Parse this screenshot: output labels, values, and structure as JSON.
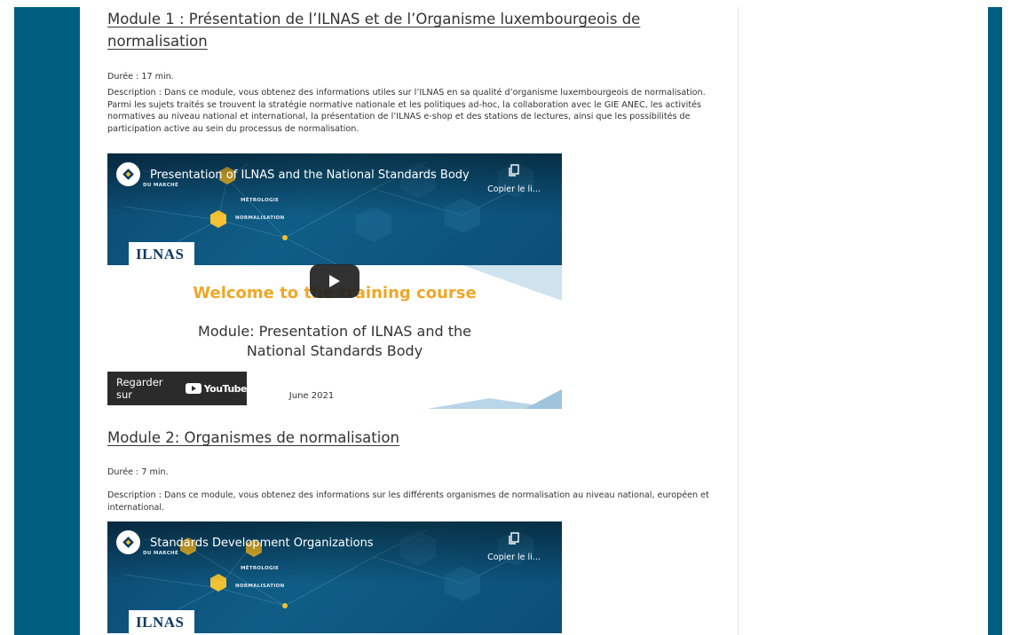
{
  "modules": [
    {
      "title": "Module 1 : Présentation de l’ILNAS et de l’Organisme luxembourgeois de normalisation",
      "duration": "Durée : 17 min.",
      "description": "Description : Dans ce module, vous obtenez des informations utiles sur l’ILNAS en sa qualité d’organisme luxembourgeois de normalisation. Parmi les sujets traités se trouvent la stratégie normative nationale et les politiques ad-hoc, la collaboration avec le GIE ANEC, les activités normatives au niveau national et international, la présentation de l’ILNAS e-shop et des stations de lectures, ainsi que les possibilités de participation active au sein du processus de normalisation.",
      "video": {
        "title": "Presentation of ILNAS and the National Standards Body",
        "copy_label": "Copier le li...",
        "welcome": "Welcome to the training course",
        "module_line1": "Module: Presentation of ILNAS and the",
        "module_line2": "National Standards Body",
        "date": "June 2021",
        "watch_label": "Regarder sur",
        "youtube_word": "YouTube",
        "logo_text": "ILNAS",
        "tag_metrologie": "MÉTROLOGIE",
        "tag_normalisation": "NORMALISATION",
        "tag_marche": "DU MARCHÉ"
      }
    },
    {
      "title": "Module 2: Organismes de normalisation",
      "duration": "Durée : 7 min.",
      "description": "Description : Dans ce module, vous obtenez des informations sur les différents organismes de normalisation au niveau national, européen et international.",
      "video": {
        "title": "Standards Development Organizations",
        "copy_label": "Copier le li...",
        "logo_text": "ILNAS",
        "tag_metrologie": "MÉTROLOGIE",
        "tag_normalisation": "NORMALISATION",
        "tag_marche": "DU MARCHÉ"
      }
    }
  ],
  "colors": {
    "band": "#005f80",
    "accent_title": "#f0a726",
    "video_bg": "#0c4a72"
  }
}
